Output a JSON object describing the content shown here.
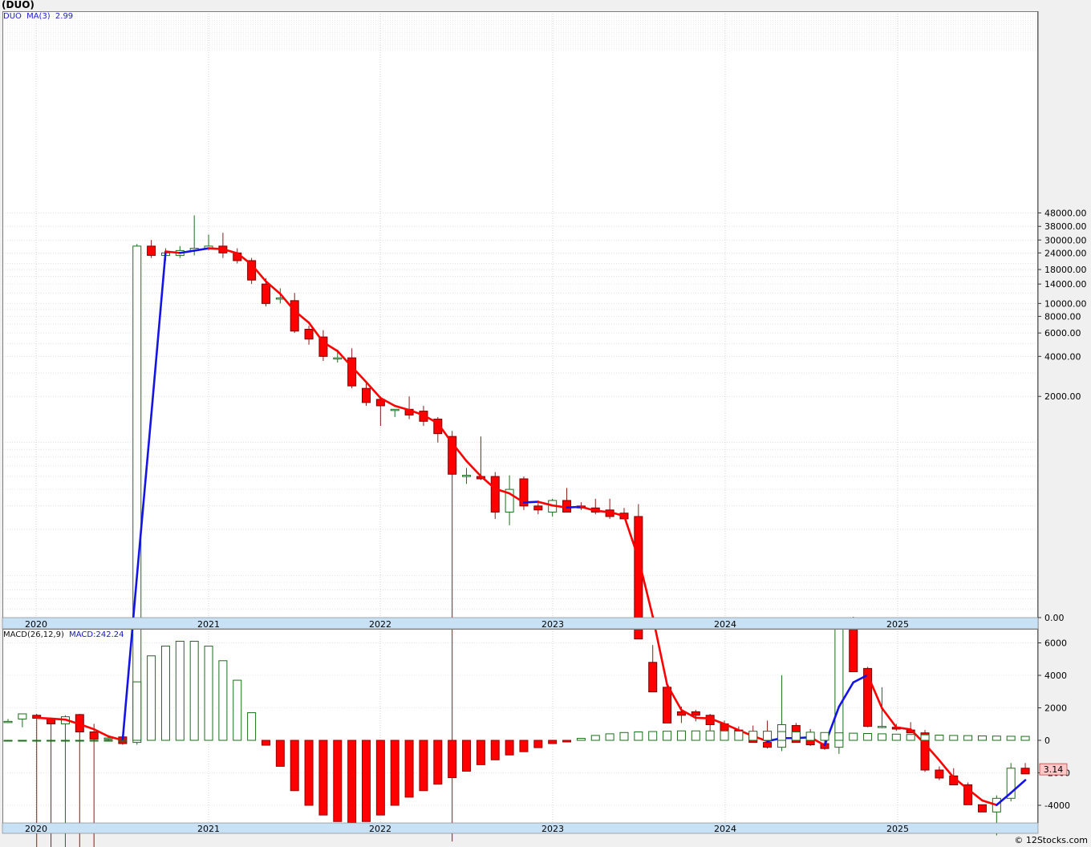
{
  "header": {
    "title": "(DUO)"
  },
  "legend_main": {
    "symbol": "DUO",
    "ma_label": "MA(3)",
    "ma_value": "2.99"
  },
  "legend_macd": {
    "label": "MACD(26,12,9)",
    "value_label": "MACD:242.24"
  },
  "price_tag": "3.14",
  "watermark": "© 12Stocks.com",
  "colors": {
    "up": "#1a6e1a",
    "down": "#ff0000",
    "ma_up": "#1414e6",
    "ma_down": "#ff0000",
    "axis_bar": "#c8e1f5",
    "tag": "#ffc8c8"
  },
  "chart_data": [
    {
      "type": "candlestick",
      "title": "(DUO)",
      "scale": "log",
      "price_ticks": [
        "48000.00",
        "38000.00",
        "30000.00",
        "24000.00",
        "18000.00",
        "14000.00",
        "10000.00",
        "8000.00",
        "6000.00",
        "4000.00",
        "2000.00",
        "0.00"
      ],
      "x_ticks": [
        "2020",
        "2021",
        "2022",
        "2023",
        "2024",
        "2025"
      ],
      "last": 3.14,
      "ma": {
        "name": "MA(3)",
        "value": 2.99
      },
      "candles": [
        [
          7.2,
          7.5,
          7.0,
          7.2
        ],
        [
          7.5,
          7.6,
          6.5,
          8.2
        ],
        [
          8.0,
          8.2,
          0.5,
          7.6
        ],
        [
          7.6,
          7.6,
          0.5,
          6.9
        ],
        [
          6.9,
          8.0,
          0.5,
          7.8
        ],
        [
          8.1,
          8.2,
          0.5,
          6.0
        ],
        [
          6.0,
          6.9,
          0.5,
          5.3
        ],
        [
          5.4,
          5.6,
          5.2,
          5.4
        ],
        [
          5.5,
          5.6,
          4.8,
          4.9
        ],
        [
          5.0,
          28000,
          4.8,
          27000
        ],
        [
          27000,
          30000,
          22000,
          23000
        ],
        [
          23000,
          26000,
          21000,
          24000
        ],
        [
          23000,
          27000,
          22000,
          25000
        ],
        [
          25000,
          46000,
          23000,
          26000
        ],
        [
          26000,
          33000,
          25000,
          27000
        ],
        [
          27000,
          34000,
          22000,
          24000
        ],
        [
          24000,
          26000,
          20000,
          21000
        ],
        [
          21000,
          22000,
          14000,
          15000
        ],
        [
          14000,
          15500,
          9500,
          10000
        ],
        [
          11000,
          13000,
          10000,
          11000
        ],
        [
          10500,
          12000,
          6000,
          6200
        ],
        [
          6400,
          6800,
          4900,
          5400
        ],
        [
          5600,
          6300,
          3700,
          4000
        ],
        [
          3900,
          4500,
          3600,
          3900
        ],
        [
          3900,
          4600,
          2300,
          2400
        ],
        [
          2300,
          2500,
          1700,
          1800
        ],
        [
          1900,
          2000,
          1200,
          1700
        ],
        [
          1600,
          1600,
          1400,
          1600
        ],
        [
          1600,
          2000,
          1350,
          1450
        ],
        [
          1550,
          1700,
          1200,
          1300
        ],
        [
          1350,
          1400,
          900,
          1050
        ],
        [
          1000,
          1100,
          0.9,
          520
        ],
        [
          500,
          580,
          440,
          510
        ],
        [
          500,
          1000,
          470,
          480
        ],
        [
          500,
          540,
          240,
          270
        ],
        [
          270,
          510,
          215,
          400
        ],
        [
          480,
          500,
          280,
          300
        ],
        [
          300,
          330,
          260,
          280
        ],
        [
          270,
          340,
          250,
          330
        ],
        [
          330,
          410,
          290,
          270
        ],
        [
          300,
          320,
          280,
          290
        ],
        [
          290,
          340,
          260,
          270
        ],
        [
          280,
          340,
          240,
          250
        ],
        [
          265,
          290,
          240,
          240
        ],
        [
          250,
          310,
          30,
          30
        ],
        [
          20,
          27,
          13,
          12
        ],
        [
          13,
          14,
          7.1,
          7.0
        ],
        [
          8.5,
          9.3,
          7.0,
          8.0
        ],
        [
          8.5,
          8.8,
          7.2,
          8.0
        ],
        [
          8.0,
          8.2,
          5.9,
          6.8
        ],
        [
          6.9,
          7.3,
          6.1,
          6.0
        ],
        [
          6.2,
          6.6,
          5.8,
          5.8
        ],
        [
          5.9,
          6.7,
          5.0,
          5.0
        ],
        [
          5.0,
          7.3,
          4.5,
          4.6
        ],
        [
          4.6,
          16,
          4.3,
          6.8
        ],
        [
          6.7,
          7.0,
          5.2,
          5.0
        ],
        [
          5.5,
          6.3,
          4.7,
          4.8
        ],
        [
          4.9,
          5.2,
          4.4,
          4.5
        ],
        [
          4.6,
          37,
          4.1,
          37
        ],
        [
          37,
          44,
          17,
          17
        ],
        [
          18,
          18.5,
          6.5,
          6.6
        ],
        [
          6.5,
          13,
          6.4,
          6.6
        ],
        [
          6.5,
          6.9,
          6.1,
          6.3
        ],
        [
          6.2,
          7.1,
          5.9,
          5.9
        ],
        [
          5.9,
          6.2,
          3.0,
          3.1
        ],
        [
          3.1,
          3.3,
          2.6,
          2.7
        ],
        [
          2.8,
          3.2,
          2.4,
          2.4
        ],
        [
          2.4,
          2.5,
          1.7,
          1.7
        ],
        [
          1.7,
          1.7,
          1.5,
          1.5
        ],
        [
          1.5,
          2.0,
          1.0,
          1.9
        ],
        [
          1.9,
          3.5,
          1.8,
          3.2
        ],
        [
          3.2,
          3.5,
          2.9,
          2.9
        ]
      ]
    },
    {
      "type": "histogram",
      "title": "MACD(26,12,9)",
      "value": 242.24,
      "y_ticks": [
        "6000",
        "4000",
        "2000",
        "0",
        "-2000",
        "-4000"
      ],
      "x_ticks": [
        "2020",
        "2021",
        "2022",
        "2023",
        "2024",
        "2025"
      ],
      "values": [
        0,
        0,
        0,
        0,
        0,
        0,
        0,
        0,
        0,
        3600,
        5200,
        5800,
        6100,
        6100,
        5800,
        4900,
        3700,
        1700,
        -300,
        -1600,
        -3100,
        -4000,
        -4600,
        -5000,
        -5100,
        -5000,
        -4600,
        -4000,
        -3500,
        -3100,
        -2700,
        -2300,
        -1900,
        -1500,
        -1200,
        -900,
        -700,
        -450,
        -200,
        -100,
        120,
        300,
        400,
        480,
        520,
        540,
        560,
        580,
        580,
        580,
        580,
        570,
        560,
        560,
        540,
        520,
        500,
        480,
        460,
        440,
        420,
        400,
        380,
        360,
        340,
        320,
        300,
        290,
        270,
        260,
        250,
        242.24
      ]
    }
  ]
}
